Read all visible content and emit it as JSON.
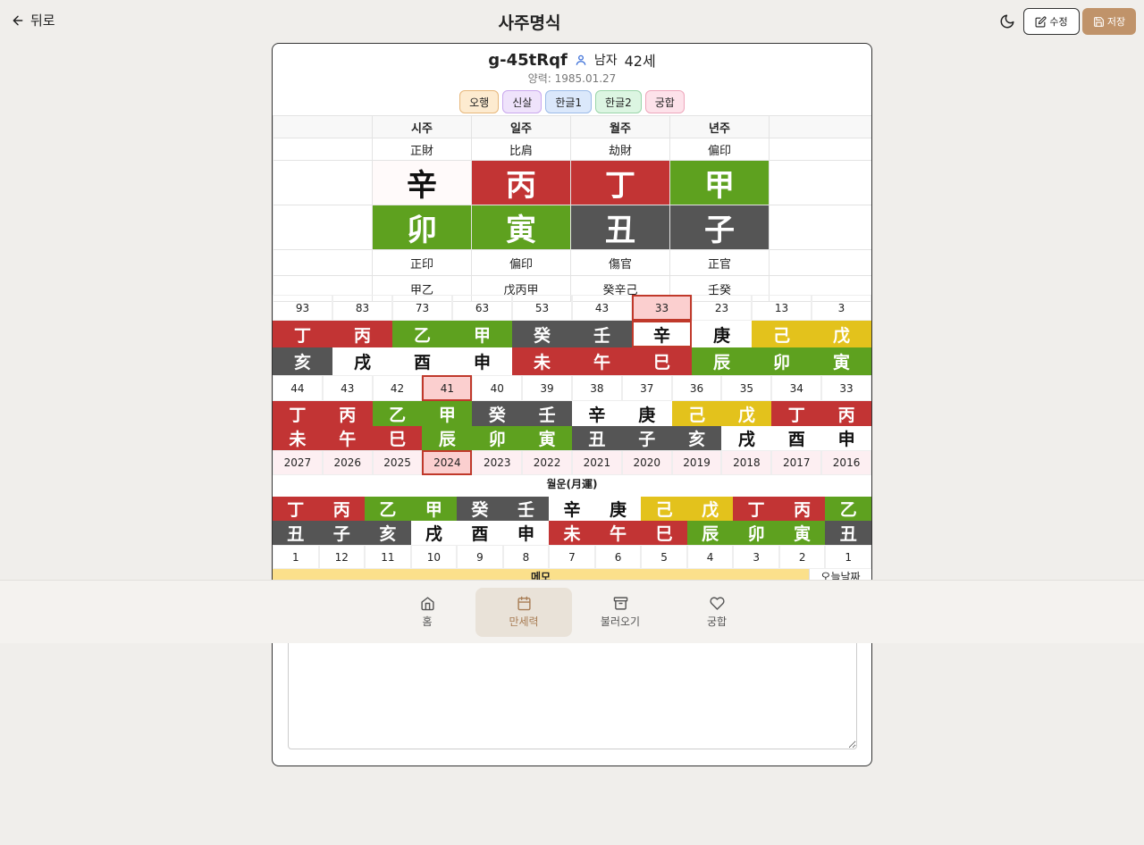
{
  "header": {
    "back_label": "뒤로",
    "title": "사주명식",
    "edit_label": "수정",
    "save_label": "저장"
  },
  "profile": {
    "name": "g-45tRqf",
    "gender": "남자",
    "age": "42세",
    "solar": "양력: 1985.01.27"
  },
  "tabs": [
    {
      "label": "오행",
      "bg": "#fdebd0",
      "border": "#e7b77b"
    },
    {
      "label": "신살",
      "bg": "#efe3fb",
      "border": "#c9a8ee"
    },
    {
      "label": "한글1",
      "bg": "#dbe8fb",
      "border": "#9cbbe8"
    },
    {
      "label": "한글2",
      "bg": "#dcf5e2",
      "border": "#9ad5aa"
    },
    {
      "label": "궁합",
      "bg": "#fde2ea",
      "border": "#eea6bb"
    }
  ],
  "colors": {
    "red": "#c23434",
    "green": "#5ea11f",
    "dark": "#555555",
    "yellow": "#e3c21c",
    "white": "#ffffff"
  },
  "pillars": {
    "headers": [
      "시주",
      "일주",
      "월주",
      "년주"
    ],
    "top_gods": [
      "正財",
      "比肩",
      "劫財",
      "偏印"
    ],
    "stems": [
      {
        "c": "辛",
        "color": "white"
      },
      {
        "c": "丙",
        "color": "red"
      },
      {
        "c": "丁",
        "color": "red"
      },
      {
        "c": "甲",
        "color": "green"
      }
    ],
    "branches": [
      {
        "c": "卯",
        "color": "green"
      },
      {
        "c": "寅",
        "color": "green"
      },
      {
        "c": "丑",
        "color": "dark"
      },
      {
        "c": "子",
        "color": "dark"
      }
    ],
    "bottom_gods": [
      "正印",
      "偏印",
      "傷官",
      "正官"
    ],
    "hidden": [
      "甲乙",
      "戊丙甲",
      "癸辛己",
      "壬癸"
    ]
  },
  "daeun": {
    "ages": [
      "93",
      "83",
      "73",
      "63",
      "53",
      "43",
      "33",
      "23",
      "13",
      "3"
    ],
    "selected_index": 6,
    "stems": [
      {
        "c": "丁",
        "color": "red"
      },
      {
        "c": "丙",
        "color": "red"
      },
      {
        "c": "乙",
        "color": "green"
      },
      {
        "c": "甲",
        "color": "green"
      },
      {
        "c": "癸",
        "color": "dark"
      },
      {
        "c": "壬",
        "color": "dark"
      },
      {
        "c": "辛",
        "color": "white"
      },
      {
        "c": "庚",
        "color": "white"
      },
      {
        "c": "己",
        "color": "yellow"
      },
      {
        "c": "戊",
        "color": "yellow"
      }
    ],
    "branches": [
      {
        "c": "亥",
        "color": "dark"
      },
      {
        "c": "戌",
        "color": "white"
      },
      {
        "c": "酉",
        "color": "white"
      },
      {
        "c": "申",
        "color": "white"
      },
      {
        "c": "未",
        "color": "red"
      },
      {
        "c": "午",
        "color": "red"
      },
      {
        "c": "巳",
        "color": "red"
      },
      {
        "c": "辰",
        "color": "green"
      },
      {
        "c": "卯",
        "color": "green"
      },
      {
        "c": "寅",
        "color": "green"
      }
    ]
  },
  "seun": {
    "ages": [
      "44",
      "43",
      "42",
      "41",
      "40",
      "39",
      "38",
      "37",
      "36",
      "35",
      "34",
      "33"
    ],
    "selected_index": 3,
    "stems": [
      {
        "c": "丁",
        "color": "red"
      },
      {
        "c": "丙",
        "color": "red"
      },
      {
        "c": "乙",
        "color": "green"
      },
      {
        "c": "甲",
        "color": "green"
      },
      {
        "c": "癸",
        "color": "dark"
      },
      {
        "c": "壬",
        "color": "dark"
      },
      {
        "c": "辛",
        "color": "white"
      },
      {
        "c": "庚",
        "color": "white"
      },
      {
        "c": "己",
        "color": "yellow"
      },
      {
        "c": "戊",
        "color": "yellow"
      },
      {
        "c": "丁",
        "color": "red"
      },
      {
        "c": "丙",
        "color": "red"
      }
    ],
    "branches": [
      {
        "c": "未",
        "color": "red"
      },
      {
        "c": "午",
        "color": "red"
      },
      {
        "c": "巳",
        "color": "red"
      },
      {
        "c": "辰",
        "color": "green"
      },
      {
        "c": "卯",
        "color": "green"
      },
      {
        "c": "寅",
        "color": "green"
      },
      {
        "c": "丑",
        "color": "dark"
      },
      {
        "c": "子",
        "color": "dark"
      },
      {
        "c": "亥",
        "color": "dark"
      },
      {
        "c": "戌",
        "color": "white"
      },
      {
        "c": "酉",
        "color": "white"
      },
      {
        "c": "申",
        "color": "white"
      }
    ],
    "years": [
      "2027",
      "2026",
      "2025",
      "2024",
      "2023",
      "2022",
      "2021",
      "2020",
      "2019",
      "2018",
      "2017",
      "2016"
    ]
  },
  "wolun": {
    "title": "월운(月運)",
    "stems": [
      {
        "c": "丁",
        "color": "red"
      },
      {
        "c": "丙",
        "color": "red"
      },
      {
        "c": "乙",
        "color": "green"
      },
      {
        "c": "甲",
        "color": "green"
      },
      {
        "c": "癸",
        "color": "dark"
      },
      {
        "c": "壬",
        "color": "dark"
      },
      {
        "c": "辛",
        "color": "white"
      },
      {
        "c": "庚",
        "color": "white"
      },
      {
        "c": "己",
        "color": "yellow"
      },
      {
        "c": "戊",
        "color": "yellow"
      },
      {
        "c": "丁",
        "color": "red"
      },
      {
        "c": "丙",
        "color": "red"
      },
      {
        "c": "乙",
        "color": "green"
      }
    ],
    "branches": [
      {
        "c": "丑",
        "color": "dark"
      },
      {
        "c": "子",
        "color": "dark"
      },
      {
        "c": "亥",
        "color": "dark"
      },
      {
        "c": "戌",
        "color": "white"
      },
      {
        "c": "酉",
        "color": "white"
      },
      {
        "c": "申",
        "color": "white"
      },
      {
        "c": "未",
        "color": "red"
      },
      {
        "c": "午",
        "color": "red"
      },
      {
        "c": "巳",
        "color": "red"
      },
      {
        "c": "辰",
        "color": "green"
      },
      {
        "c": "卯",
        "color": "green"
      },
      {
        "c": "寅",
        "color": "green"
      },
      {
        "c": "丑",
        "color": "dark"
      }
    ],
    "months": [
      "1",
      "12",
      "11",
      "10",
      "9",
      "8",
      "7",
      "6",
      "5",
      "4",
      "3",
      "2",
      "1"
    ]
  },
  "memo": {
    "label": "메모",
    "side_label": "오늘날짜"
  },
  "nav": [
    {
      "label": "홈",
      "icon": "home-icon"
    },
    {
      "label": "만세력",
      "icon": "calendar-icon"
    },
    {
      "label": "불러오기",
      "icon": "archive-icon"
    },
    {
      "label": "궁합",
      "icon": "heart-icon"
    }
  ]
}
